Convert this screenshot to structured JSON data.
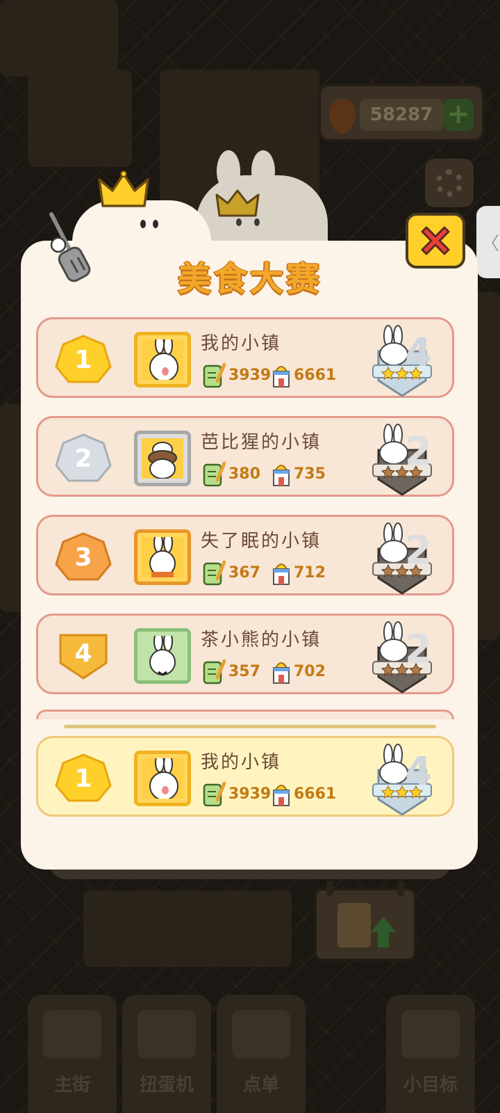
{
  "background": {
    "carrot_balance": "58287",
    "bottom_nav": [
      "主街",
      "扭蛋机",
      "点单",
      "小目标"
    ]
  },
  "panel": {
    "title": "美食大赛",
    "close_icon": "close-x-icon"
  },
  "colors": {
    "gold_rank": "#ffd02a",
    "silver_rank": "#d7dde2",
    "bronze_rank": "#f6a34a",
    "row_border": "#e49a8c",
    "row_fill": "#f8e6d6",
    "my_row_fill": "#fff4c0",
    "stat_text": "#c27a14"
  },
  "rankings": [
    {
      "rank": "1",
      "name": "我的小镇",
      "score": "3939",
      "popularity": "6661",
      "level": "4",
      "level_stars": 3
    },
    {
      "rank": "2",
      "name": "芭比猩的小镇",
      "score": "380",
      "popularity": "735",
      "level": "2",
      "level_stars": 3
    },
    {
      "rank": "3",
      "name": "失了眠的小镇",
      "score": "367",
      "popularity": "712",
      "level": "2",
      "level_stars": 3
    },
    {
      "rank": "4",
      "name": "茶小熊的小镇",
      "score": "357",
      "popularity": "702",
      "level": "2",
      "level_stars": 3
    }
  ],
  "my_entry": {
    "rank": "1",
    "name": "我的小镇",
    "score": "3939",
    "popularity": "6661",
    "level": "4",
    "level_stars": 3
  }
}
